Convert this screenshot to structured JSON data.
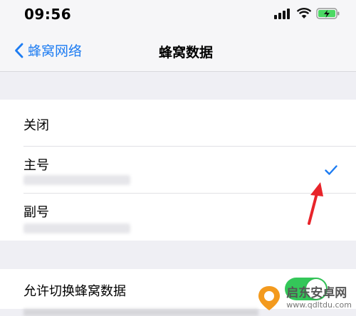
{
  "status_bar": {
    "time": "09:56"
  },
  "nav": {
    "back_label": "蜂窝网络",
    "title": "蜂窝数据"
  },
  "options": [
    {
      "label": "关闭",
      "selected": false
    },
    {
      "label": "主号",
      "selected": true
    },
    {
      "label": "副号",
      "selected": false
    }
  ],
  "settings": {
    "allow_switch_label": "允许切换蜂窝数据",
    "allow_switch_on": true
  },
  "watermark": {
    "title": "启东安卓网",
    "url": "www.qdltdu.com"
  },
  "colors": {
    "accent": "#1d7cf2",
    "toggle_on": "#34c759",
    "annotation_arrow": "#e8242a"
  }
}
